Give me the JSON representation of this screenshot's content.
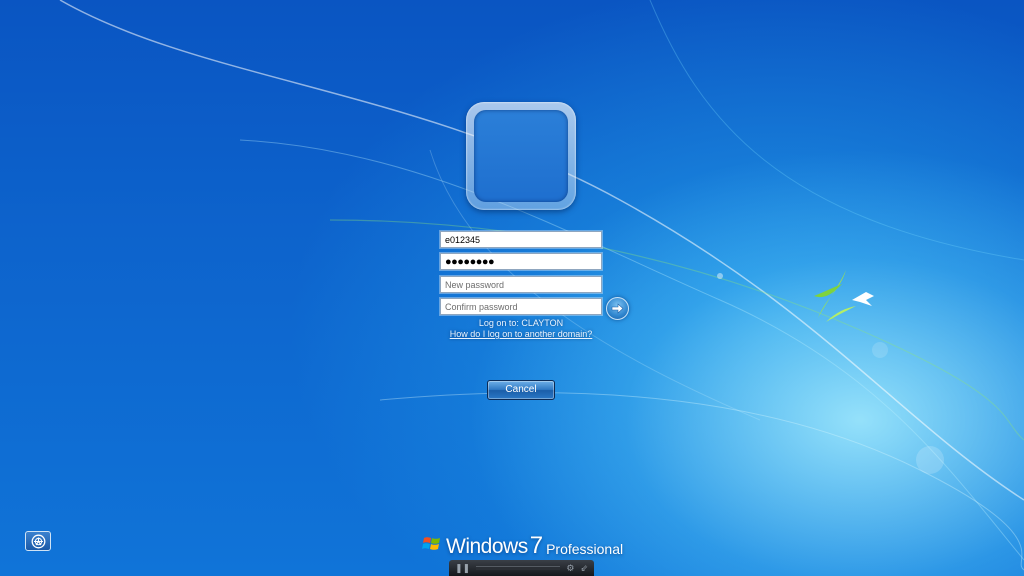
{
  "login": {
    "username_value": "e012345",
    "password_value": "●●●●●●●●",
    "new_password_placeholder": "New password",
    "confirm_password_placeholder": "Confirm password",
    "logon_to": "Log on to: CLAYTON",
    "domain_link": "How do I log on to another domain?",
    "cancel_label": "Cancel"
  },
  "brand": {
    "name": "Windows",
    "version": "7",
    "edition": "Professional"
  },
  "icons": {
    "submit": "arrow-right-icon",
    "ease_of_access": "ease-of-access-icon",
    "logo": "windows-flag-icon",
    "pause": "pause-icon",
    "settings": "gear-icon",
    "fullscreen": "fullscreen-icon"
  }
}
